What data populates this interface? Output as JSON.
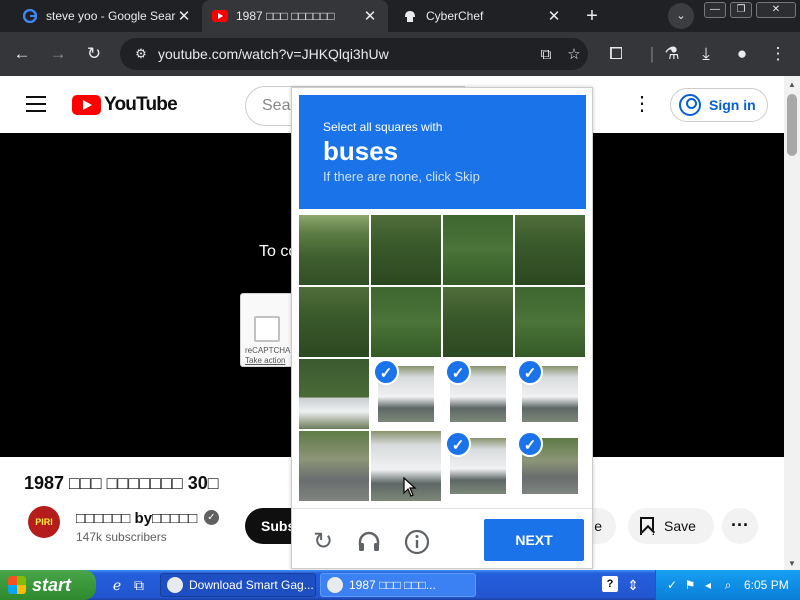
{
  "browser": {
    "tabs": [
      {
        "title": "steve yoo - Google Sear",
        "icon": "google-icon"
      },
      {
        "title": "1987 □□□ □□□□□□",
        "icon": "youtube-icon"
      },
      {
        "title": "CyberChef",
        "icon": "cyberchef-icon"
      }
    ],
    "new_tab": "+",
    "url": "youtube.com/watch?v=JHKQlqi3hUw"
  },
  "youtube": {
    "logo_text": "YouTube",
    "search_placeholder": "Sear",
    "signin_label": "Sign in",
    "player_message": "To co",
    "recaptcha_mini": {
      "label": "reCAPTCHA",
      "link": "Take action"
    },
    "video_title": "1987 □□□ □□□□□□□ 30□",
    "channel": {
      "name": "□□□□□□ by□□□□□",
      "subscribers": "147k subscribers",
      "avatar_text": "PIRI"
    },
    "subscribe_label": "Subs",
    "share_fragment": "e",
    "save_label": "Save"
  },
  "captcha": {
    "instruction": "Select all squares with",
    "target": "buses",
    "hint": "If there are none, click Skip",
    "tiles_selected": [
      6,
      7,
      8,
      13,
      14
    ],
    "next_label": "NEXT",
    "colors": {
      "accent": "#1a73e8"
    }
  },
  "taskbar": {
    "start_label": "start",
    "items": [
      {
        "label": "Download Smart Gag..."
      },
      {
        "label": "1987 □□□ □□□..."
      }
    ],
    "time": "6:05 PM"
  }
}
